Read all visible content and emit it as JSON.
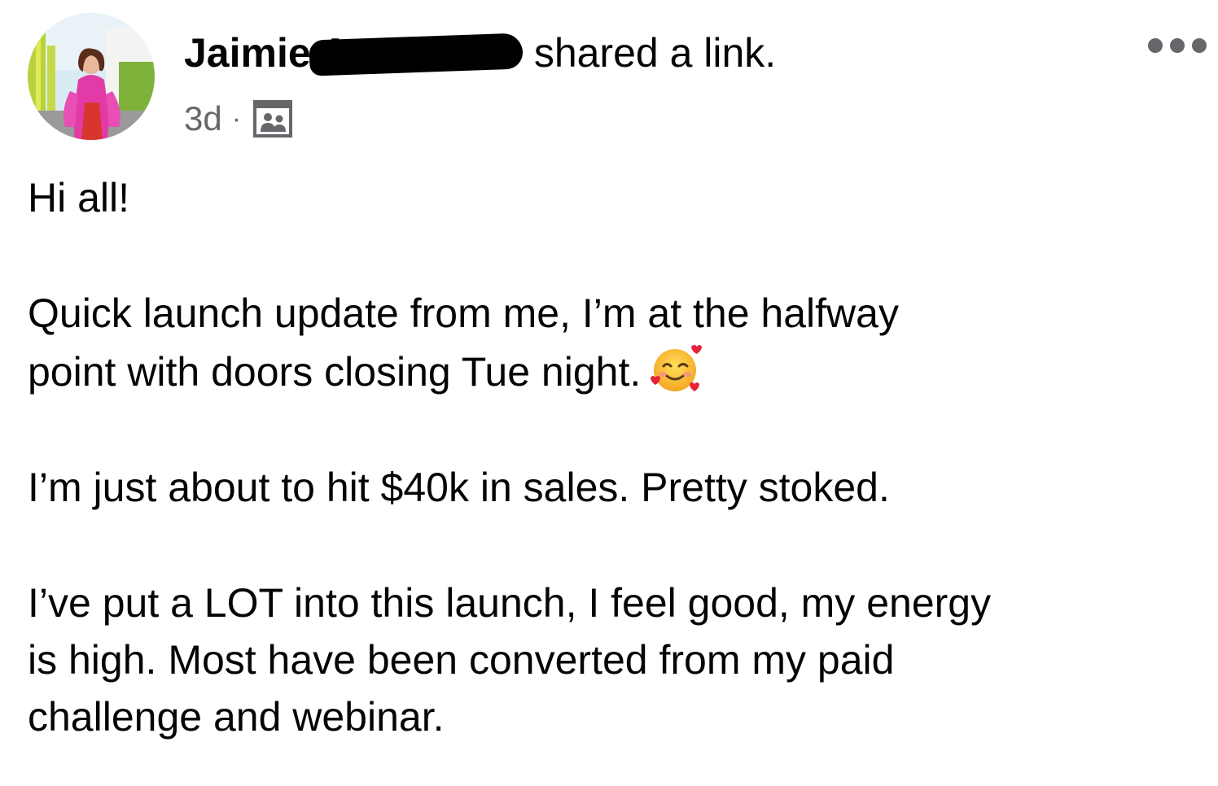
{
  "post": {
    "author_name": "Jaimie A",
    "action": "shared a link.",
    "timestamp": "3d",
    "separator": "·",
    "audience_icon": "group-icon",
    "more_icon": "more-options-icon",
    "paragraphs": [
      [
        "Hi all!"
      ],
      [
        "Quick launch update from me, I’m at the halfway",
        "point with doors closing Tue night."
      ],
      [
        "I’m just about to hit $40k in sales. Pretty stoked."
      ],
      [
        "I’ve put a LOT into this launch, I feel good, my energy",
        "is high. Most have been converted from my paid",
        "challenge and webinar."
      ]
    ],
    "emoji": "smiling-face-with-hearts-icon"
  },
  "colors": {
    "text": "#050505",
    "secondary_text": "#65676b",
    "background": "#ffffff"
  }
}
